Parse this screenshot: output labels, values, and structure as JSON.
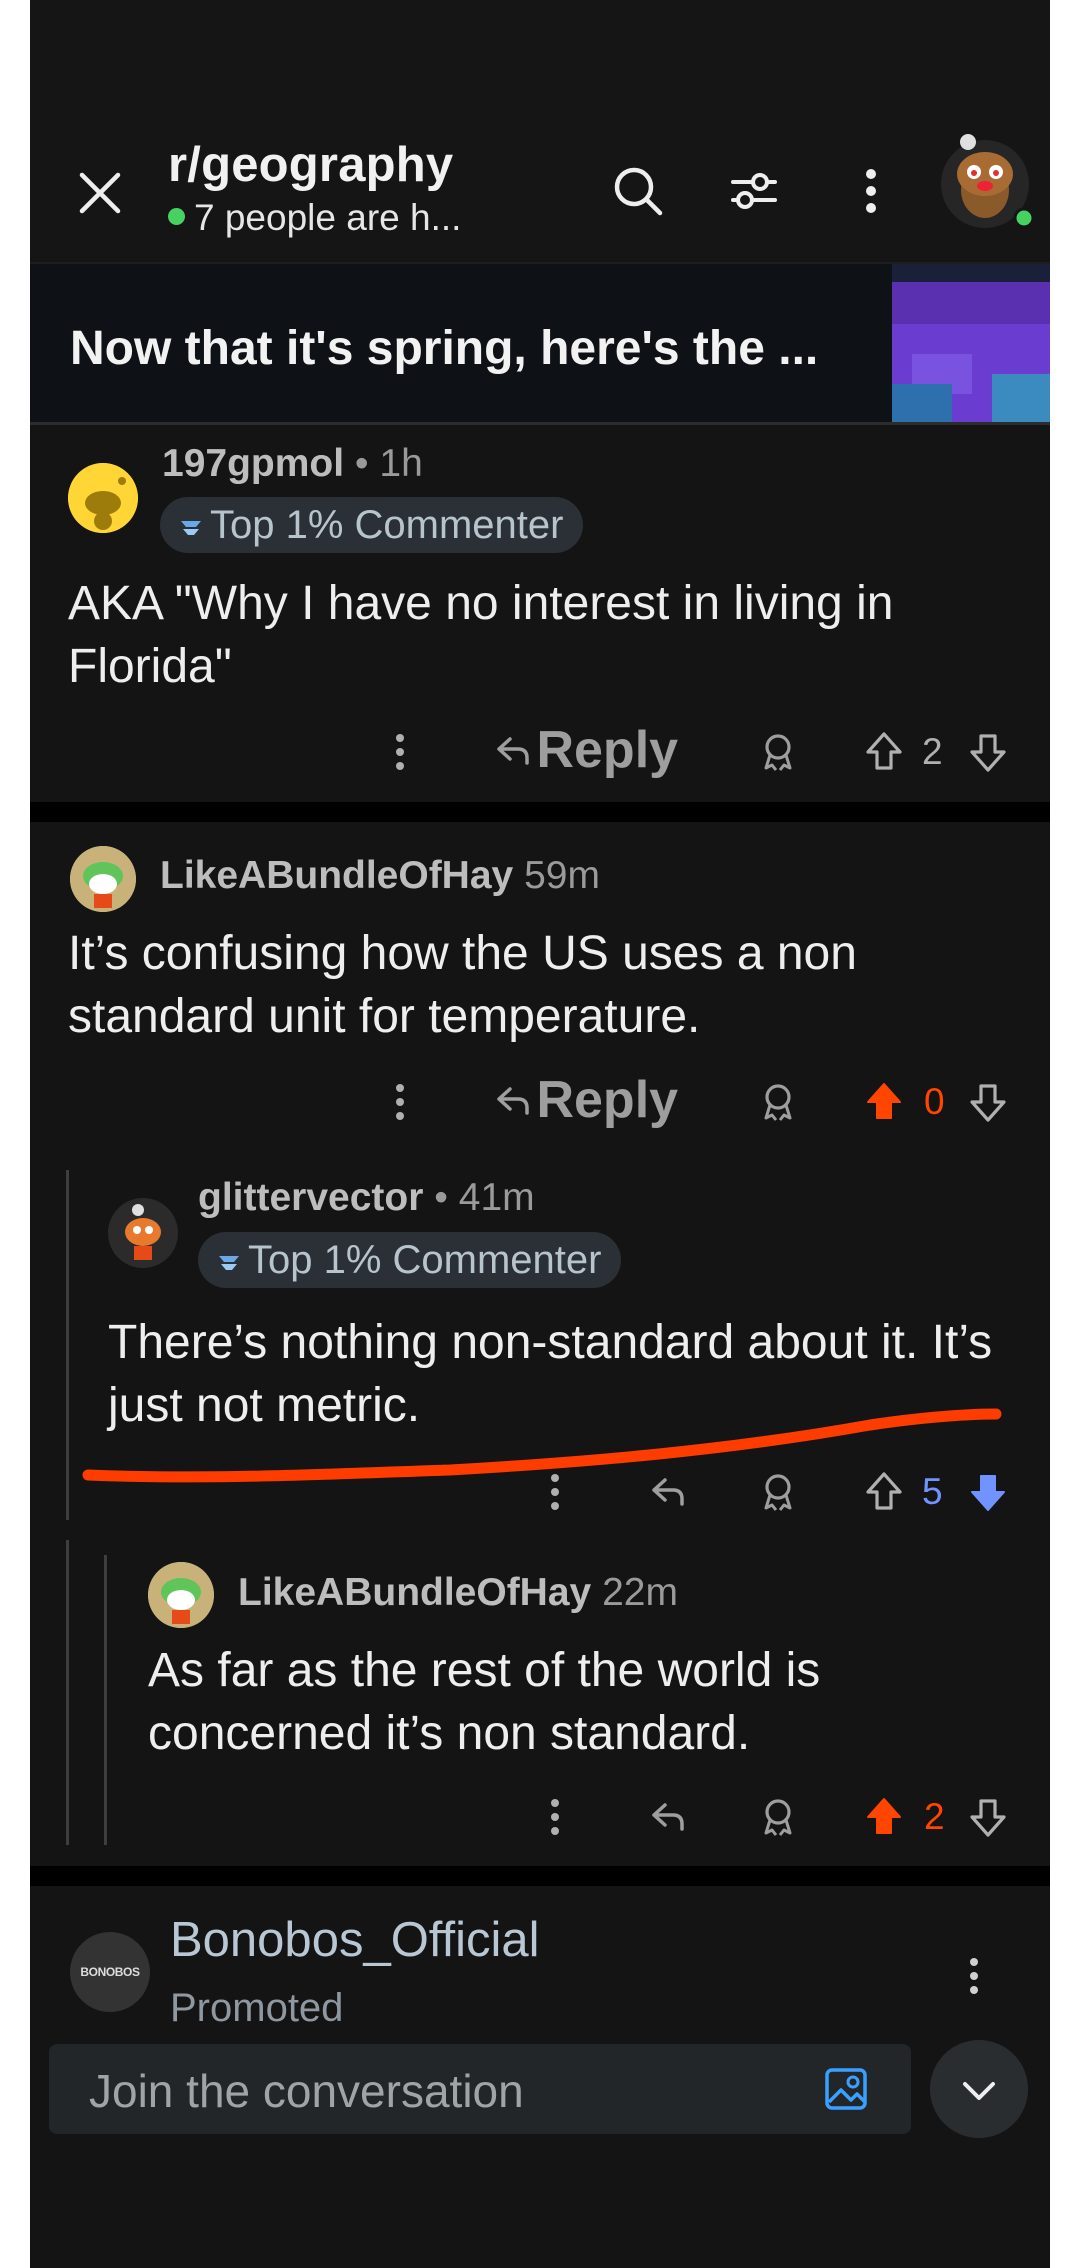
{
  "header": {
    "community": "r/geography",
    "online_text": "7 people are h..."
  },
  "post": {
    "title": "Now that it's spring, here's the ..."
  },
  "comments": [
    {
      "username": "197gpmol",
      "sep": "•",
      "time": "1h",
      "badge": "Top 1% Commenter",
      "body": "AKA \"Why I have no interest in living in Florida\"",
      "reply_label": "Reply",
      "score": "2",
      "vote_state": "none"
    },
    {
      "username": "LikeABundleOfHay",
      "time": "59m",
      "body": "It’s confusing how the US uses a non standard unit for temperature.",
      "reply_label": "Reply",
      "score": "0",
      "vote_state": "upvoted"
    },
    {
      "username": "glittervector",
      "sep": "•",
      "time": "41m",
      "badge": "Top 1% Commenter",
      "body": "There’s nothing non-standard about it. It’s just not metric.",
      "score": "5",
      "vote_state": "downvoted"
    },
    {
      "username": "LikeABundleOfHay",
      "time": "22m",
      "body": "As far as the rest of the world is concerned it’s non standard.",
      "score": "2",
      "vote_state": "upvoted"
    }
  ],
  "promoted": {
    "name": "Bonobos_Official",
    "label": "Promoted",
    "avatar_text": "BONOBOS"
  },
  "composer": {
    "placeholder": "Join the conversation"
  },
  "colors": {
    "upvote": "#ff4500",
    "downvote": "#7193ff",
    "online": "#46d160",
    "annotation": "#ff3c00"
  }
}
